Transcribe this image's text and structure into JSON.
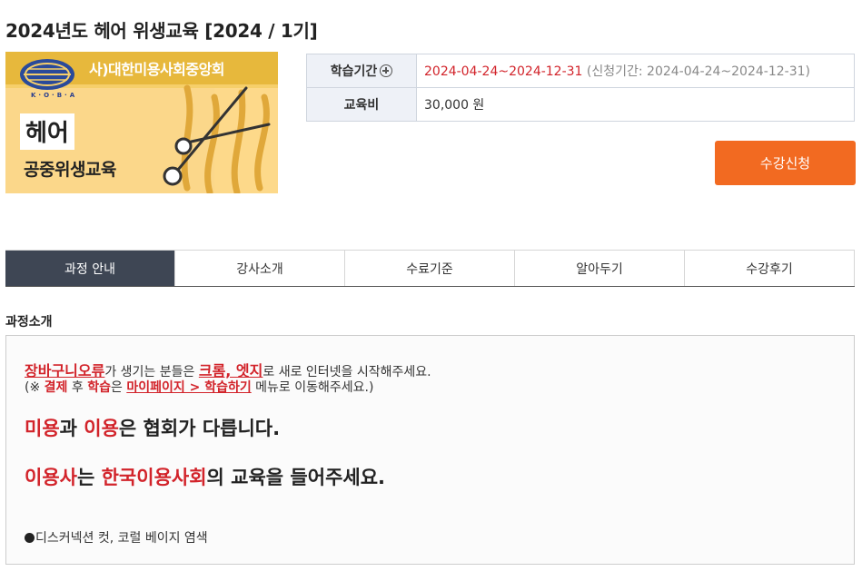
{
  "page": {
    "title": "2024년도 헤어 위생교육 [2024 / 1기]"
  },
  "course_image": {
    "org_name": "사)대한미용사회중앙회",
    "logo_text": "K·O·B·A",
    "category": "헤어",
    "subtitle": "공중위생교육"
  },
  "info": {
    "period_label": "학습기간",
    "period_value": "2024-04-24~2024-12-31",
    "apply_period": "(신청기간: 2024-04-24~2024-12-31)",
    "fee_label": "교육비",
    "fee_value": "30,000 원"
  },
  "enroll_button": "수강신청",
  "tabs": [
    {
      "label": "과정 안내",
      "active": true
    },
    {
      "label": "강사소개",
      "active": false
    },
    {
      "label": "수료기준",
      "active": false
    },
    {
      "label": "알아두기",
      "active": false
    },
    {
      "label": "수강후기",
      "active": false
    }
  ],
  "section_title": "과정소개",
  "intro": {
    "l1_a": "장바구니오류",
    "l1_b": "가 생기는 분들은 ",
    "l1_c": "크롬, 엣지",
    "l1_d": "로 새로 인터넷을 시작해주세요.",
    "l2_a": "(※ ",
    "l2_b": "결제",
    "l2_c": " 후 ",
    "l2_d": "학습",
    "l2_e": "은 ",
    "l2_f": "마이페이지 > 학습하기",
    "l2_g": " 메뉴로 이동해주세요.)",
    "l3_a": "미용",
    "l3_b": "과 ",
    "l3_c": "이용",
    "l3_d": "은 협회가 다릅니다.",
    "l4_a": "이용사",
    "l4_b": "는 ",
    "l4_c": "한국이용사회",
    "l4_d": "의 교육을 들어주세요.",
    "l5": "디스커넥션 컷, 코럴 베이지 염색"
  },
  "colors": {
    "accent": "#f26a21",
    "highlight_red": "#d2232a",
    "active_tab": "#3e4654",
    "table_header_bg": "#eef1f7"
  }
}
